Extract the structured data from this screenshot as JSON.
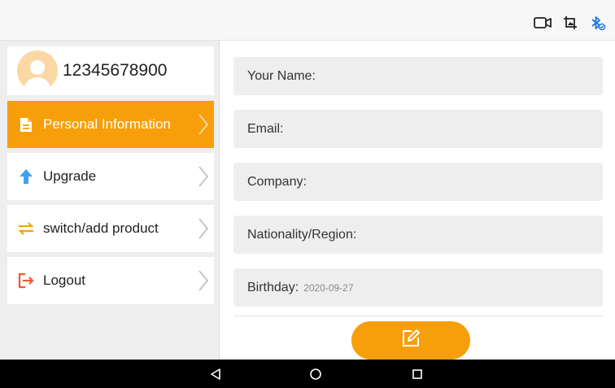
{
  "status_bar": {
    "icons": [
      "video-camera-icon",
      "image-crop-icon",
      "bluetooth-icon"
    ],
    "bluetooth_color": "#1a73e8"
  },
  "profile": {
    "phone": "12345678900",
    "avatar_color": "#fbd8a3"
  },
  "menu": {
    "items": [
      {
        "label": "Personal Information",
        "icon": "document-icon",
        "active": true
      },
      {
        "label": "Upgrade",
        "icon": "arrow-up-icon",
        "active": false
      },
      {
        "label": "switch/add product",
        "icon": "swap-arrows-icon",
        "active": false
      },
      {
        "label": "Logout",
        "icon": "logout-icon",
        "active": false
      }
    ],
    "accent_color": "#f79f0a"
  },
  "form": {
    "fields": [
      {
        "label": "Your Name:",
        "value": ""
      },
      {
        "label": "Email:",
        "value": ""
      },
      {
        "label": "Company:",
        "value": ""
      },
      {
        "label": "Nationality/Region:",
        "value": ""
      },
      {
        "label": "Birthday:",
        "value": "2020-09-27"
      }
    ],
    "edit_button_icon": "edit-icon"
  },
  "nav_bar": {
    "buttons": [
      "back-icon",
      "home-icon",
      "recents-icon"
    ]
  }
}
